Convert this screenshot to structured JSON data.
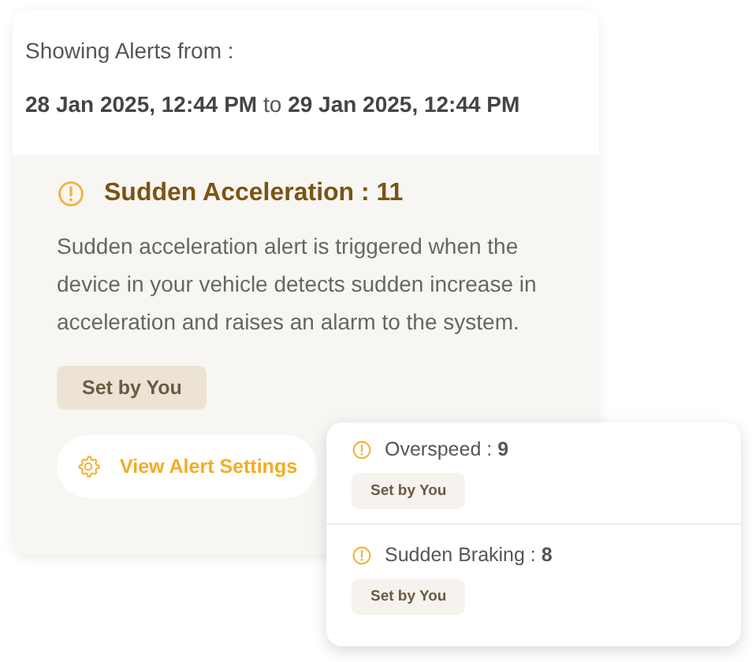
{
  "range": {
    "label": "Showing Alerts from :",
    "value": "**28 Jan 2025, 12:44 PM** to **29 Jan 2025, 12:44 PM**"
  },
  "detail": {
    "title": "Sudden Acceleration : 11",
    "description": "Sudden acceleration alert is triggered when the device in your vehicle detects sudden increase in acceleration and raises an alarm to the system.",
    "tag": "Set by You",
    "action": "View Alert Settings"
  },
  "alerts": [
    {
      "title": "Overspeed : **9**",
      "tag": "Set by You"
    },
    {
      "title": "Sudden Braking : **8**",
      "tag": "Set by You"
    }
  ]
}
